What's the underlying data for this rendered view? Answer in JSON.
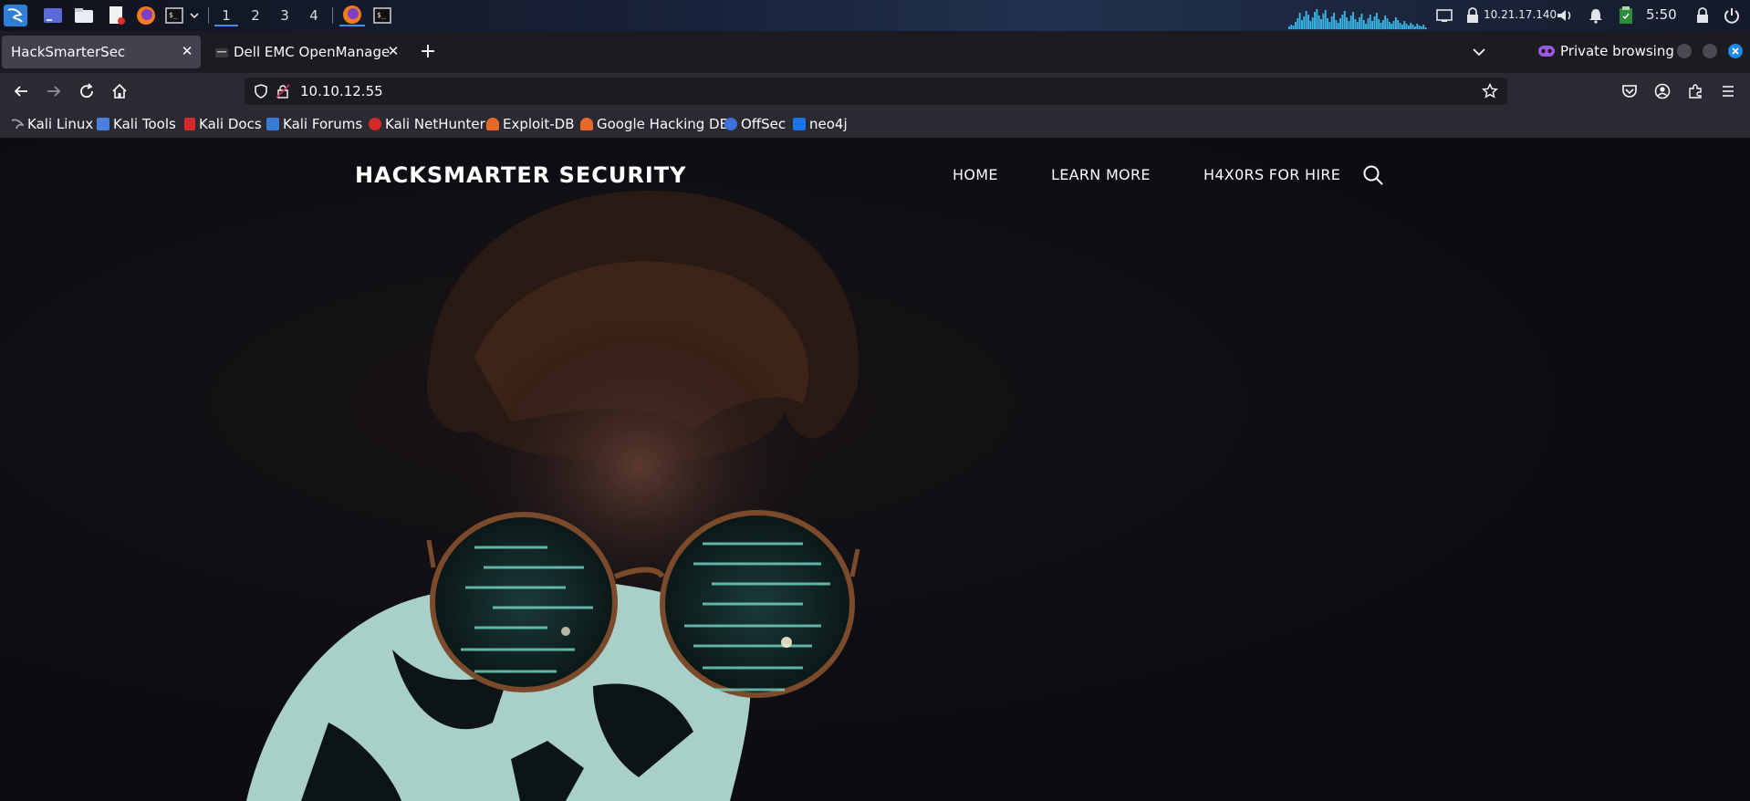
{
  "panel": {
    "workspaces": [
      "1",
      "2",
      "3",
      "4"
    ],
    "active_workspace": "1",
    "ip_address": "10.21.17.140",
    "clock": "5:50",
    "icons": [
      "kali-menu-icon",
      "desktop-icon",
      "file-manager-icon",
      "text-editor-icon",
      "firefox-icon",
      "terminal-icon",
      "chevron-down-icon",
      "firefox-window-icon",
      "terminal-window-icon",
      "network-graph-icon",
      "display-icon",
      "vpn-icon",
      "volume-icon",
      "notification-bell-icon",
      "clipboard-icon",
      "lock-icon",
      "power-icon"
    ]
  },
  "browser": {
    "tabs": [
      {
        "title": "HackSmarterSec",
        "selected": true
      },
      {
        "title": "Dell EMC OpenManage",
        "selected": false
      }
    ],
    "private_label": "Private browsing",
    "url": "10.10.12.55",
    "bookmarks": [
      {
        "label": "Kali Linux",
        "icon_color": "#9aa0a6"
      },
      {
        "label": "Kali Tools",
        "icon_color": "#4a7fe0"
      },
      {
        "label": "Kali Docs",
        "icon_color": "#d42a2a"
      },
      {
        "label": "Kali Forums",
        "icon_color": "#3a7bd5"
      },
      {
        "label": "Kali NetHunter",
        "icon_color": "#d42a2a"
      },
      {
        "label": "Exploit-DB",
        "icon_color": "#e8692a"
      },
      {
        "label": "Google Hacking DB",
        "icon_color": "#e8692a"
      },
      {
        "label": "OffSec",
        "icon_color": "#3d6fd8"
      },
      {
        "label": "neo4j",
        "icon_color": "#1a73e8"
      }
    ]
  },
  "site": {
    "title": "HACKSMARTER SECURITY",
    "nav": [
      "HOME",
      "LEARN MORE",
      "H4X0RS FOR HIRE"
    ]
  },
  "colors": {
    "accent": "#3d8cf0",
    "private_purple": "#9b59e0",
    "close_button": "#1e88e5"
  }
}
